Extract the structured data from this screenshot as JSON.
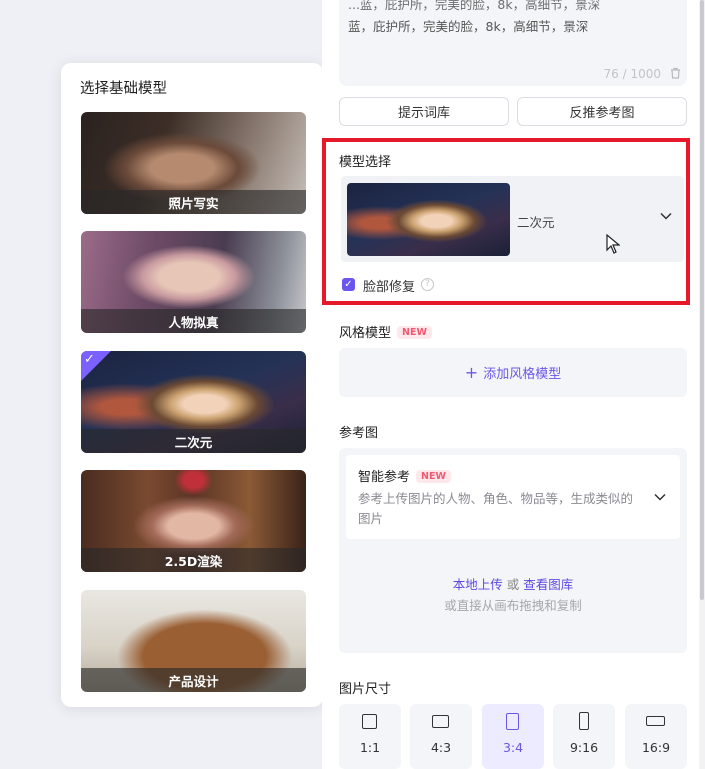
{
  "model_popup": {
    "title": "选择基础模型",
    "cards": [
      {
        "label": "照片写实",
        "selected": false
      },
      {
        "label": "人物拟真",
        "selected": false
      },
      {
        "label": "二次元",
        "selected": true
      },
      {
        "label": "2.5D渲染",
        "selected": false
      },
      {
        "label": "产品设计",
        "selected": false
      }
    ],
    "check_mark": "✓"
  },
  "prompt": {
    "text_line_partial": "...蓝，庇护所，完美的脸，8k，高细节，景深",
    "text": "蓝，庇护所，完美的脸，8k，高细节，景深",
    "count": "76 / 1000"
  },
  "buttons": {
    "prompt_library": "提示词库",
    "reverse_reference": "反推参考图"
  },
  "model_select": {
    "section_label": "模型选择",
    "value": "二次元",
    "face_fix_label": "脸部修复",
    "face_fix_checked": true,
    "help": "?"
  },
  "style_model": {
    "section_label": "风格模型",
    "badge": "NEW",
    "add_label": "添加风格模型"
  },
  "reference": {
    "section_label": "参考图",
    "smart_title": "智能参考",
    "badge": "NEW",
    "smart_desc": "参考上传图片的人物、角色、物品等，生成类似的图片",
    "upload_local": "本地上传",
    "or": "或",
    "view_gallery": "查看图库",
    "drag_hint": "或直接从画布拖拽和复制"
  },
  "image_size": {
    "section_label": "图片尺寸",
    "ratios": [
      {
        "label": "1:1",
        "active": false
      },
      {
        "label": "4:3",
        "active": false
      },
      {
        "label": "3:4",
        "active": true
      },
      {
        "label": "9:16",
        "active": false
      },
      {
        "label": "16:9",
        "active": false
      }
    ]
  },
  "colors": {
    "accent": "#6a57e6",
    "highlight": "#e5192a"
  }
}
